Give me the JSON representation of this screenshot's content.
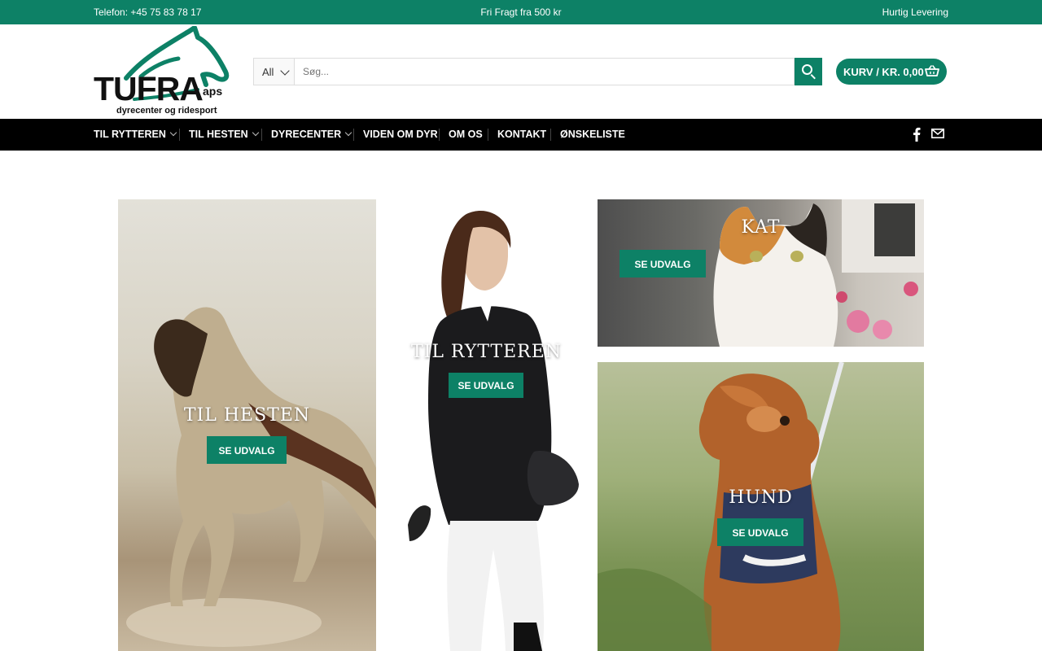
{
  "topbar": {
    "phone": "Telefon: +45 75 83 78 17",
    "free_shipping": "Fri Fragt fra 500 kr",
    "fast_delivery": "Hurtig Levering"
  },
  "logo": {
    "word": "TUFRA",
    "suffix": "aps",
    "tagline": "dyrecenter og ridesport"
  },
  "search": {
    "category": "All",
    "placeholder": "Søg..."
  },
  "cart": {
    "label": "KURV / KR. 0,00"
  },
  "nav": {
    "items": [
      {
        "label": "TIL RYTTEREN"
      },
      {
        "label": "TIL HESTEN"
      },
      {
        "label": "DYRECENTER"
      },
      {
        "label": "VIDEN OM DYR"
      },
      {
        "label": "OM OS"
      },
      {
        "label": "KONTAKT"
      },
      {
        "label": "ØNSKELISTE"
      }
    ],
    "icons": [
      "facebook-icon",
      "mail-icon"
    ]
  },
  "tiles": [
    {
      "title": "TIL HESTEN",
      "button": "SE UDVALG"
    },
    {
      "title": "TIL RYTTEREN",
      "button": "SE UDVALG"
    },
    {
      "title": "KAT",
      "button": "SE UDVALG"
    },
    {
      "title": "HUND",
      "button": "SE UDVALG"
    }
  ],
  "colors": {
    "brand": "#0d8166",
    "nav_bg": "#000000"
  }
}
